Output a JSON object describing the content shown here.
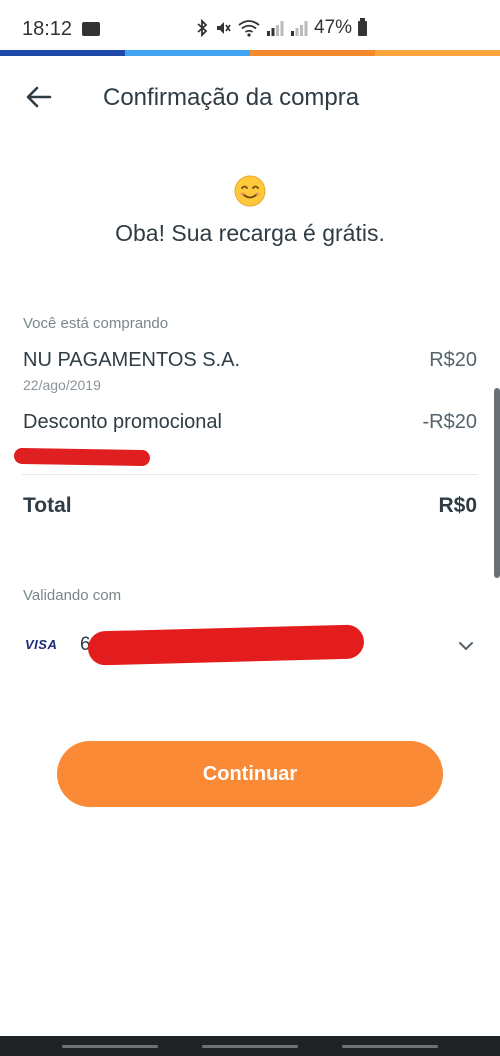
{
  "status_bar": {
    "time": "18:12",
    "battery": "47%"
  },
  "header": {
    "title": "Confirmação da compra"
  },
  "message": {
    "text": "Oba! Sua recarga é grátis."
  },
  "purchase": {
    "section_label": "Você está comprando",
    "item_name": "NU PAGAMENTOS S.A.",
    "item_value": "R$20",
    "item_date": "22/ago/2019",
    "discount_label": "Desconto promocional",
    "discount_value": "-R$20",
    "total_label": "Total",
    "total_value": "R$0"
  },
  "payment": {
    "section_label": "Validando com",
    "card_brand": "VISA",
    "card_number_visible": "6"
  },
  "actions": {
    "continue_label": "Continuar"
  },
  "colors": {
    "accent_orange": "#fa8a36",
    "text_dark": "#2f3c44",
    "redaction_red": "#e31d1d"
  },
  "icons": {
    "back": "arrow-left-icon",
    "emoji": "smiling-face-icon",
    "dropdown": "chevron-down-icon"
  }
}
